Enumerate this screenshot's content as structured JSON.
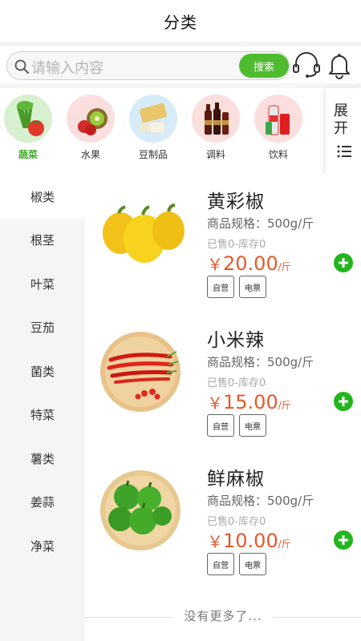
{
  "header": {
    "title": "分类"
  },
  "search": {
    "placeholder": "请输入内容",
    "button_label": "搜索"
  },
  "categories": [
    {
      "label": "蔬菜",
      "active": true
    },
    {
      "label": "水果",
      "active": false
    },
    {
      "label": "豆制品",
      "active": false
    },
    {
      "label": "调料",
      "active": false
    },
    {
      "label": "饮料",
      "active": false
    }
  ],
  "expand": {
    "label": "展开"
  },
  "sidebar": {
    "items": [
      {
        "label": "椒类",
        "active": true
      },
      {
        "label": "根茎",
        "active": false
      },
      {
        "label": "叶菜",
        "active": false
      },
      {
        "label": "豆茄",
        "active": false
      },
      {
        "label": "菌类",
        "active": false
      },
      {
        "label": "特菜",
        "active": false
      },
      {
        "label": "薯类",
        "active": false
      },
      {
        "label": "姜蒜",
        "active": false
      },
      {
        "label": "净菜",
        "active": false
      }
    ]
  },
  "products": [
    {
      "name": "黄彩椒",
      "spec": "商品规格：500g/斤",
      "sold": "已售0-库存0",
      "currency": "￥",
      "price": "20.00",
      "unit": "/斤",
      "tag1": "自营",
      "tag2": "电票"
    },
    {
      "name": "小米辣",
      "spec": "商品规格：500g/斤",
      "sold": "已售0-库存0",
      "currency": "￥",
      "price": "15.00",
      "unit": "/斤",
      "tag1": "自营",
      "tag2": "电票"
    },
    {
      "name": "鲜麻椒",
      "spec": "商品规格：500g/斤",
      "sold": "已售0-库存0",
      "currency": "￥",
      "price": "10.00",
      "unit": "/斤",
      "tag1": "自营",
      "tag2": "电票"
    }
  ],
  "footer": {
    "no_more": "没有更多了..."
  },
  "colors": {
    "accent_green": "#4ebc2e",
    "price_red": "#e8582a",
    "add_green": "#21b61c"
  }
}
